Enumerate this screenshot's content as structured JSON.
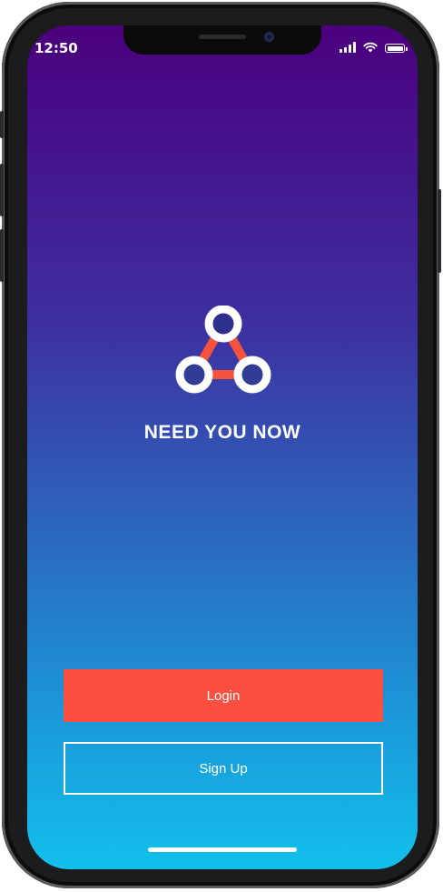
{
  "status_bar": {
    "time": "12:50",
    "icons": [
      "cellular-signal-icon",
      "wifi-icon",
      "battery-icon"
    ]
  },
  "app": {
    "name": "NEED YOU NOW",
    "logo": "three-connected-rings-logo"
  },
  "actions": {
    "login_label": "Login",
    "signup_label": "Sign Up"
  },
  "colors": {
    "gradient_top": "#4b007d",
    "gradient_bottom": "#12c0ea",
    "login_button": "#fb4f3f",
    "logo_accent": "#f5533d",
    "text": "#ffffff"
  }
}
